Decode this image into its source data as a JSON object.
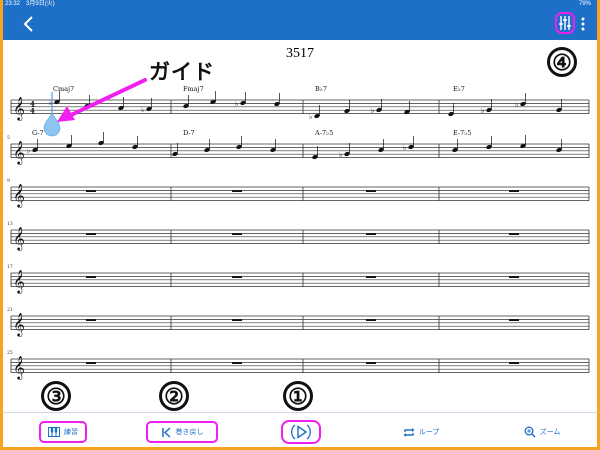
{
  "status": {
    "time_date": "23:32　3月9日(火)",
    "battery": "79%"
  },
  "score": {
    "title": "3517",
    "guide_label": "ガイド",
    "chords": [
      {
        "symbol": "Cmaj7",
        "measure": 1
      },
      {
        "symbol": "Fmaj7",
        "measure": 2
      },
      {
        "symbol": "B♭7",
        "measure": 3
      },
      {
        "symbol": "E♭7",
        "measure": 4
      },
      {
        "symbol": "G-7",
        "measure": 5
      },
      {
        "symbol": "D-7",
        "measure": 6
      },
      {
        "symbol": "A-7♭5",
        "measure": 7
      },
      {
        "symbol": "E-7♭5",
        "measure": 8
      }
    ],
    "measure_numbers": [
      "5",
      "9",
      "13",
      "17",
      "21",
      "25"
    ],
    "time_signature": {
      "top": "4",
      "bottom": "4"
    }
  },
  "toolbar": {
    "practice_label": "練習",
    "rewind_label": "巻き戻し",
    "loop_label": "ループ",
    "zoom_label": "ズーム"
  },
  "annotations": {
    "badge_1": "①",
    "badge_2": "②",
    "badge_3": "③",
    "badge_4": "④"
  },
  "colors": {
    "accent": "#1e6fc8",
    "highlight": "#f01ef0",
    "frame": "#f4a51c",
    "guide_drop": "#8fc3f0"
  },
  "icons": {
    "back": "chevron-left-icon",
    "mixer": "mixer-sliders-icon",
    "more": "more-vertical-icon",
    "practice": "piano-keyboard-icon",
    "rewind": "skip-back-icon",
    "play": "play-icon",
    "loop": "loop-icon",
    "zoom": "zoom-in-icon"
  }
}
